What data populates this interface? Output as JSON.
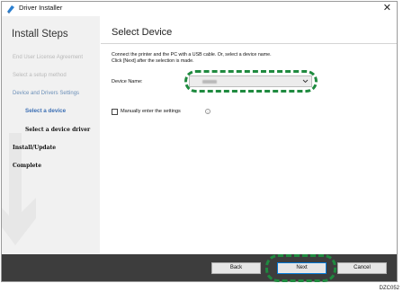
{
  "window": {
    "title": "Driver Installer",
    "close_glyph": "✕"
  },
  "sidebar": {
    "heading": "Install Steps",
    "steps": [
      {
        "label": "End User License Agreement",
        "state": "done"
      },
      {
        "label": "Select a setup method",
        "state": "done"
      },
      {
        "label": "Device and Drivers Settings",
        "state": "group"
      },
      {
        "label": "Select a device",
        "state": "current"
      },
      {
        "label": "Select a device driver",
        "state": "pending"
      },
      {
        "label": "Install/Update",
        "state": "pending"
      },
      {
        "label": "Complete",
        "state": "pending"
      }
    ]
  },
  "main": {
    "title": "Select Device",
    "instruction_line1": "Connect the printer and the PC with a USB cable. Or, select a device name.",
    "instruction_line2": "Click [Next] after the selection is made.",
    "device_name_label": "Device Name:",
    "manual_label": "Manually enter the settings",
    "manual_checked": false,
    "info_glyph": "i"
  },
  "footer": {
    "back": "Back",
    "next": "Next",
    "cancel": "Cancel"
  },
  "annotation": {
    "figure_code": "DZC052",
    "highlight_color": "#1f8a3f"
  }
}
